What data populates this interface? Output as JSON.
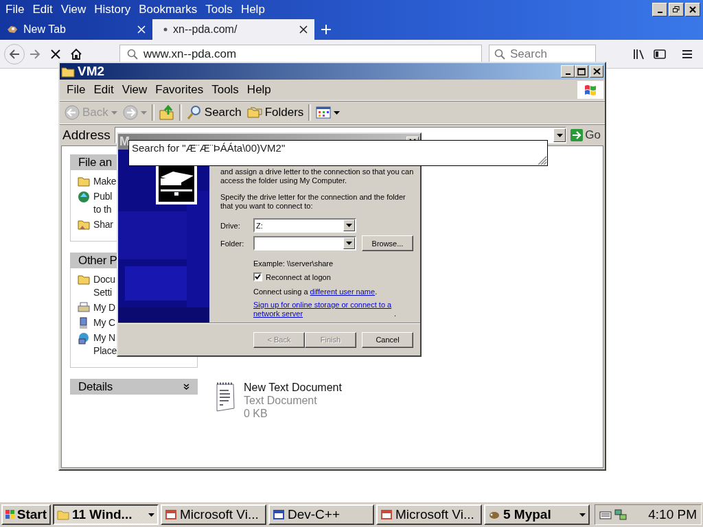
{
  "browser": {
    "menu": [
      "File",
      "Edit",
      "View",
      "History",
      "Bookmarks",
      "Tools",
      "Help"
    ],
    "tabs": [
      {
        "label": "New Tab",
        "selected": false
      },
      {
        "label": "xn--pda.com/",
        "selected": true
      }
    ],
    "url": "www.xn--pda.com",
    "search": {
      "placeholder": "Search"
    }
  },
  "explorer": {
    "title": "VM2",
    "menu": [
      "File",
      "Edit",
      "View",
      "Favorites",
      "Tools",
      "Help"
    ],
    "toolbar": {
      "back": "Back",
      "search": "Search",
      "folders": "Folders"
    },
    "address": {
      "label": "Address",
      "go": "Go"
    },
    "panels": [
      {
        "title": "File an",
        "expanded": true,
        "items": [
          {
            "kind": "folder",
            "lines": [
              "Make"
            ]
          },
          {
            "kind": "web",
            "lines": [
              "Publ",
              "to th"
            ]
          },
          {
            "kind": "share",
            "lines": [
              "Shar"
            ]
          }
        ]
      },
      {
        "title": "Other P",
        "expanded": true,
        "items": [
          {
            "kind": "folder",
            "lines": [
              "Docu",
              "Setti"
            ]
          },
          {
            "kind": "printer",
            "lines": [
              "My D"
            ]
          },
          {
            "kind": "computer",
            "lines": [
              "My C"
            ]
          },
          {
            "kind": "network",
            "lines": [
              "My N",
              "Place"
            ]
          }
        ]
      },
      {
        "title": "Details",
        "expanded": false
      }
    ],
    "files": [
      {
        "name": "New Text Document",
        "type": "Text Document",
        "size": "0 KB"
      }
    ]
  },
  "dialog": {
    "title": "M",
    "intro": "and assign a drive letter to the connection so that you can access the folder using My Computer.",
    "instruction": "Specify the drive letter for the connection and the folder that you want to connect to:",
    "drive": {
      "label": "Drive:",
      "value": "Z:"
    },
    "folder": {
      "label": "Folder:"
    },
    "browse": "Browse...",
    "example": "Example: \\\\server\\share",
    "reconnect": {
      "label": "Reconnect at logon",
      "checked": true
    },
    "connect": {
      "before": "Connect using a ",
      "link": "different user name",
      "after": "."
    },
    "signup": {
      "link": "Sign up for online storage or connect to a network server",
      "after": "."
    },
    "buttons": [
      {
        "label": "< Back",
        "disabled": true
      },
      {
        "label": "Finish",
        "disabled": true
      },
      {
        "label": "Cancel",
        "disabled": false
      }
    ]
  },
  "search_popup": {
    "text": "Search for \"Æ¨Æ¨ÞÁÁta\\00)VM2\""
  },
  "taskbar": {
    "start": "Start",
    "buttons": [
      {
        "label": "11 Wind...",
        "kind": "group",
        "selected": true
      },
      {
        "label": "Microsoft Vi...",
        "kind": "app",
        "selected": false
      },
      {
        "label": "Dev-C++",
        "kind": "app",
        "selected": false
      },
      {
        "label": "Microsoft Vi...",
        "kind": "app",
        "selected": false
      },
      {
        "label": "5 Mypal",
        "kind": "group",
        "selected": false
      }
    ],
    "clock": "4:10 PM"
  }
}
